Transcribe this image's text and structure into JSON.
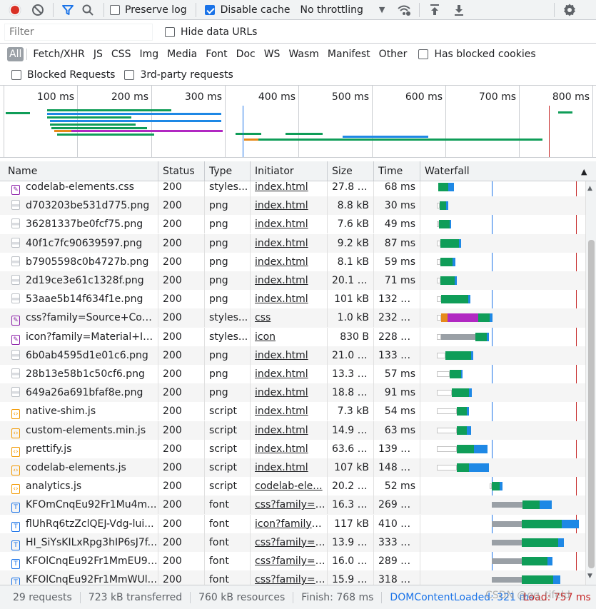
{
  "toolbar": {
    "preserve_log": "Preserve log",
    "disable_cache": "Disable cache",
    "throttling": "No throttling",
    "record_icon": "record-icon",
    "clear_icon": "clear-icon",
    "filter_icon": "filter-icon",
    "search_icon": "search-icon",
    "wifi_icon": "network-conditions-icon",
    "upload_icon": "import-har-icon",
    "download_icon": "export-har-icon",
    "gear_icon": "settings-icon"
  },
  "filter": {
    "placeholder": "Filter",
    "hide_data_urls": "Hide data URLs"
  },
  "types": {
    "all": "All",
    "fetch": "Fetch/XHR",
    "js": "JS",
    "css": "CSS",
    "img": "Img",
    "media": "Media",
    "font": "Font",
    "doc": "Doc",
    "ws": "WS",
    "wasm": "Wasm",
    "manifest": "Manifest",
    "other": "Other",
    "blocked_cookies": "Has blocked cookies"
  },
  "extra": {
    "blocked_requests": "Blocked Requests",
    "third_party": "3rd-party requests"
  },
  "overview_ticks": [
    "100 ms",
    "200 ms",
    "300 ms",
    "400 ms",
    "500 ms",
    "600 ms",
    "700 ms",
    "800 ms"
  ],
  "columns": {
    "name": "Name",
    "status": "Status",
    "type": "Type",
    "initiator": "Initiator",
    "size": "Size",
    "time": "Time",
    "waterfall": "Waterfall"
  },
  "colors": {
    "waiting": "#9aa0a6",
    "ttfb": "#0f9d58",
    "download": "#1e88e5",
    "queue": "#e0e0e0",
    "ssl": "#b128c2",
    "dns": "#e6891a",
    "dcl_line": "#1a73e8",
    "load_line": "#c62828"
  },
  "rows": [
    {
      "name": "codelab-elements.css",
      "icon": "css",
      "status": "200",
      "type": "styles...",
      "initiator": "index.html",
      "size": "27.8 kB",
      "time": "68 ms"
    },
    {
      "name": "d703203be531d775.png",
      "icon": "png",
      "status": "200",
      "type": "png",
      "initiator": "index.html",
      "size": "8.8 kB",
      "time": "30 ms"
    },
    {
      "name": "36281337be0fcf75.png",
      "icon": "png",
      "status": "200",
      "type": "png",
      "initiator": "index.html",
      "size": "7.6 kB",
      "time": "49 ms"
    },
    {
      "name": "40f1c7fc90639597.png",
      "icon": "png",
      "status": "200",
      "type": "png",
      "initiator": "index.html",
      "size": "9.2 kB",
      "time": "87 ms"
    },
    {
      "name": "b7905598c0b4727b.png",
      "icon": "png",
      "status": "200",
      "type": "png",
      "initiator": "index.html",
      "size": "8.1 kB",
      "time": "59 ms"
    },
    {
      "name": "2d19ce3e61c1328f.png",
      "icon": "png",
      "status": "200",
      "type": "png",
      "initiator": "index.html",
      "size": "20.1 kB",
      "time": "71 ms"
    },
    {
      "name": "53aae5b14f634f1e.png",
      "icon": "png",
      "status": "200",
      "type": "png",
      "initiator": "index.html",
      "size": "101 kB",
      "time": "132 ms"
    },
    {
      "name": "css?family=Source+Code...",
      "icon": "css",
      "status": "200",
      "type": "styles...",
      "initiator": "css",
      "size": "1.0 kB",
      "time": "232 ms"
    },
    {
      "name": "icon?family=Material+Ic...",
      "icon": "css",
      "status": "200",
      "type": "styles...",
      "initiator": "icon",
      "size": "830 B",
      "time": "228 ms"
    },
    {
      "name": "6b0ab4595d1e01c6.png",
      "icon": "png",
      "status": "200",
      "type": "png",
      "initiator": "index.html",
      "size": "21.0 kB",
      "time": "133 ms"
    },
    {
      "name": "28b13e58b1c50cf6.png",
      "icon": "png",
      "status": "200",
      "type": "png",
      "initiator": "index.html",
      "size": "13.3 kB",
      "time": "57 ms"
    },
    {
      "name": "649a26a691bfaf8e.png",
      "icon": "png",
      "status": "200",
      "type": "png",
      "initiator": "index.html",
      "size": "18.8 kB",
      "time": "91 ms"
    },
    {
      "name": "native-shim.js",
      "icon": "js",
      "status": "200",
      "type": "script",
      "initiator": "index.html",
      "size": "7.3 kB",
      "time": "54 ms"
    },
    {
      "name": "custom-elements.min.js",
      "icon": "js",
      "status": "200",
      "type": "script",
      "initiator": "index.html",
      "size": "14.9 kB",
      "time": "63 ms"
    },
    {
      "name": "prettify.js",
      "icon": "js",
      "status": "200",
      "type": "script",
      "initiator": "index.html",
      "size": "63.6 kB",
      "time": "139 ms"
    },
    {
      "name": "codelab-elements.js",
      "icon": "js",
      "status": "200",
      "type": "script",
      "initiator": "index.html",
      "size": "107 kB",
      "time": "148 ms"
    },
    {
      "name": "analytics.js",
      "icon": "js",
      "status": "200",
      "type": "script",
      "initiator": "codelab-ele...",
      "size": "20.2 kB",
      "time": "52 ms"
    },
    {
      "name": "KFOmCnqEu92Fr1Mu4m...",
      "icon": "font",
      "status": "200",
      "type": "font",
      "initiator": "css?family=S...",
      "size": "16.3 kB",
      "time": "269 ms"
    },
    {
      "name": "flUhRq6tzZclQEJ-Vdg-lui...",
      "icon": "font",
      "status": "200",
      "type": "font",
      "initiator": "icon?family=...",
      "size": "117 kB",
      "time": "410 ms"
    },
    {
      "name": "HI_SiYsKILxRpg3hIP6sJ7f...",
      "icon": "font",
      "status": "200",
      "type": "font",
      "initiator": "css?family=S...",
      "size": "13.9 kB",
      "time": "333 ms"
    },
    {
      "name": "KFOlCnqEu92Fr1MmEU9f...",
      "icon": "font",
      "status": "200",
      "type": "font",
      "initiator": "css?family=S...",
      "size": "16.0 kB",
      "time": "289 ms"
    },
    {
      "name": "KFOlCnqEu92Fr1MmWUl...",
      "icon": "font",
      "status": "200",
      "type": "font",
      "initiator": "css?family=S...",
      "size": "15.9 kB",
      "time": "318 ms"
    }
  ],
  "status": {
    "requests": "29 requests",
    "transferred": "723 kB transferred",
    "resources": "760 kB resources",
    "finish": "Finish: 768 ms",
    "dcl": "DOMContentLoaded: 321 ms",
    "load": "Load: 757 ms",
    "watermark": "CSDN @qq_tifeld"
  }
}
